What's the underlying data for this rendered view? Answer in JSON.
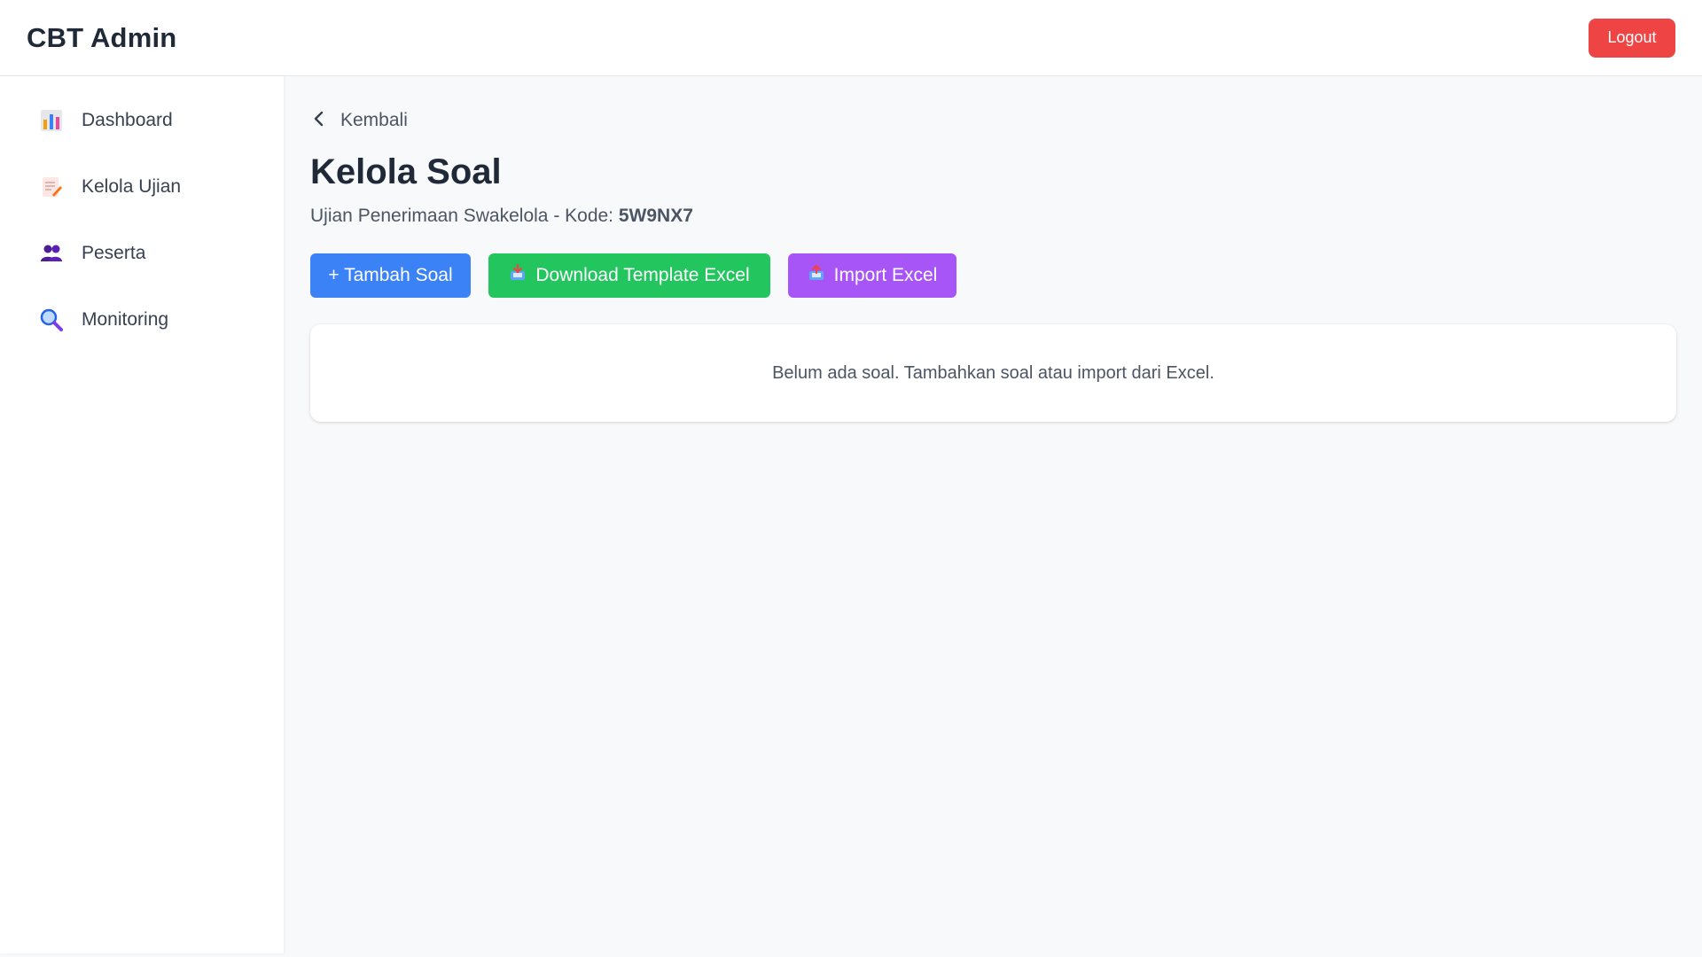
{
  "header": {
    "title": "CBT Admin",
    "logout_label": "Logout"
  },
  "sidebar": {
    "items": [
      {
        "label": "Dashboard",
        "icon": "bar-chart-icon"
      },
      {
        "label": "Kelola Ujian",
        "icon": "memo-icon"
      },
      {
        "label": "Peserta",
        "icon": "users-icon"
      },
      {
        "label": "Monitoring",
        "icon": "magnifier-icon"
      }
    ]
  },
  "main": {
    "back_label": "Kembali",
    "title": "Kelola Soal",
    "subtitle_prefix": "Ujian Penerimaan Swakelola - Kode: ",
    "exam_code": "5W9NX7",
    "actions": {
      "add_label": "+ Tambah Soal",
      "download_label": "Download Template Excel",
      "import_label": "Import Excel"
    },
    "empty_message": "Belum ada soal. Tambahkan soal atau import dari Excel."
  },
  "colors": {
    "logout": "#ef4444",
    "add": "#3b82f6",
    "download": "#22c55e",
    "import": "#a855f7"
  }
}
